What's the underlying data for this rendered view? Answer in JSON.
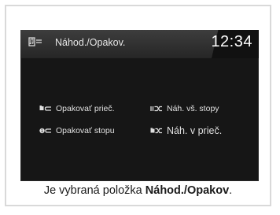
{
  "header": {
    "title": "Náhod./Opakov.",
    "clock": "12:34",
    "icon": "music-list-icon"
  },
  "options": {
    "repeat_folder": {
      "label": "Opakovať prieč.",
      "icon": "repeat-folder-icon"
    },
    "repeat_track": {
      "label": "Opakovať stopu",
      "icon": "repeat-track-icon"
    },
    "shuffle_all": {
      "label": "Náh. vš. stopy",
      "icon": "shuffle-all-icon"
    },
    "shuffle_folder": {
      "label": "Náh. v prieč.",
      "icon": "shuffle-folder-icon",
      "selected": true
    }
  },
  "caption": {
    "prefix": "Je vybraná položka ",
    "highlight": "Náhod./Opakov",
    "suffix": "."
  },
  "colors": {
    "screen_bg": "#161616",
    "text": "#e0e0e0",
    "clock": "#ffffff"
  }
}
